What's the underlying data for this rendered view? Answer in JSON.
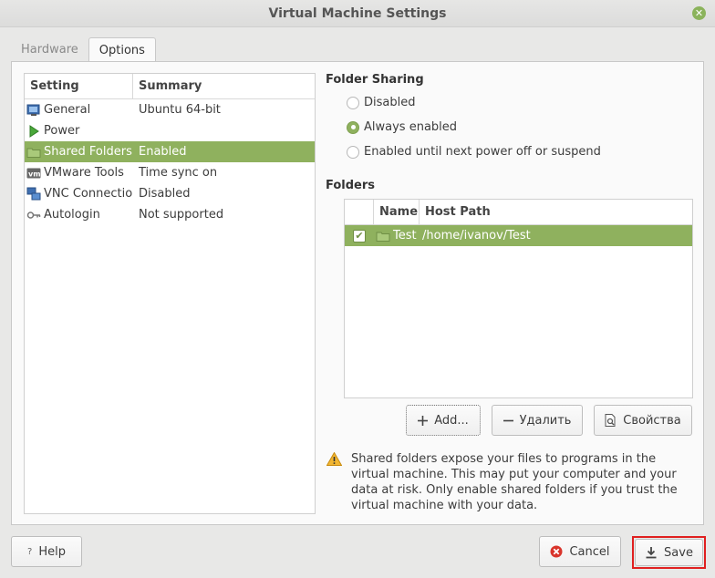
{
  "window": {
    "title": "Virtual Machine Settings"
  },
  "tabs": [
    {
      "label": "Hardware",
      "active": false
    },
    {
      "label": "Options",
      "active": true
    }
  ],
  "settings": {
    "headers": {
      "setting": "Setting",
      "summary": "Summary"
    },
    "rows": [
      {
        "icon": "general-icon",
        "setting": "General",
        "summary": "Ubuntu 64-bit"
      },
      {
        "icon": "power-icon",
        "setting": "Power",
        "summary": ""
      },
      {
        "icon": "folder-icon",
        "setting": "Shared Folders",
        "summary": "Enabled",
        "selected": true
      },
      {
        "icon": "vmware-tools-icon",
        "setting": "VMware Tools",
        "summary": "Time sync on"
      },
      {
        "icon": "vnc-icon",
        "setting": "VNC Connections",
        "summary": "Disabled"
      },
      {
        "icon": "key-icon",
        "setting": "Autologin",
        "summary": "Not supported"
      }
    ]
  },
  "folder_sharing": {
    "title": "Folder Sharing",
    "options": [
      {
        "label": "Disabled",
        "checked": false
      },
      {
        "label": "Always enabled",
        "checked": true
      },
      {
        "label": "Enabled until next power off or suspend",
        "checked": false
      }
    ]
  },
  "folders": {
    "title": "Folders",
    "headers": {
      "name": "Name",
      "host_path": "Host Path"
    },
    "rows": [
      {
        "enabled": true,
        "name": "Test",
        "host_path": "/home/ivanov/Test"
      }
    ],
    "buttons": {
      "add": "Add...",
      "remove": "Удалить",
      "properties": "Свойства"
    }
  },
  "warning": {
    "icon": "warning-icon",
    "text": "Shared folders expose your files to programs in the virtual machine. This may put your computer and your data at risk. Only enable shared folders if you trust the virtual machine with your data."
  },
  "footer": {
    "help": "Help",
    "cancel": "Cancel",
    "save": "Save"
  },
  "colors": {
    "accent": "#8fb15e",
    "highlight_frame": "#e02020"
  }
}
